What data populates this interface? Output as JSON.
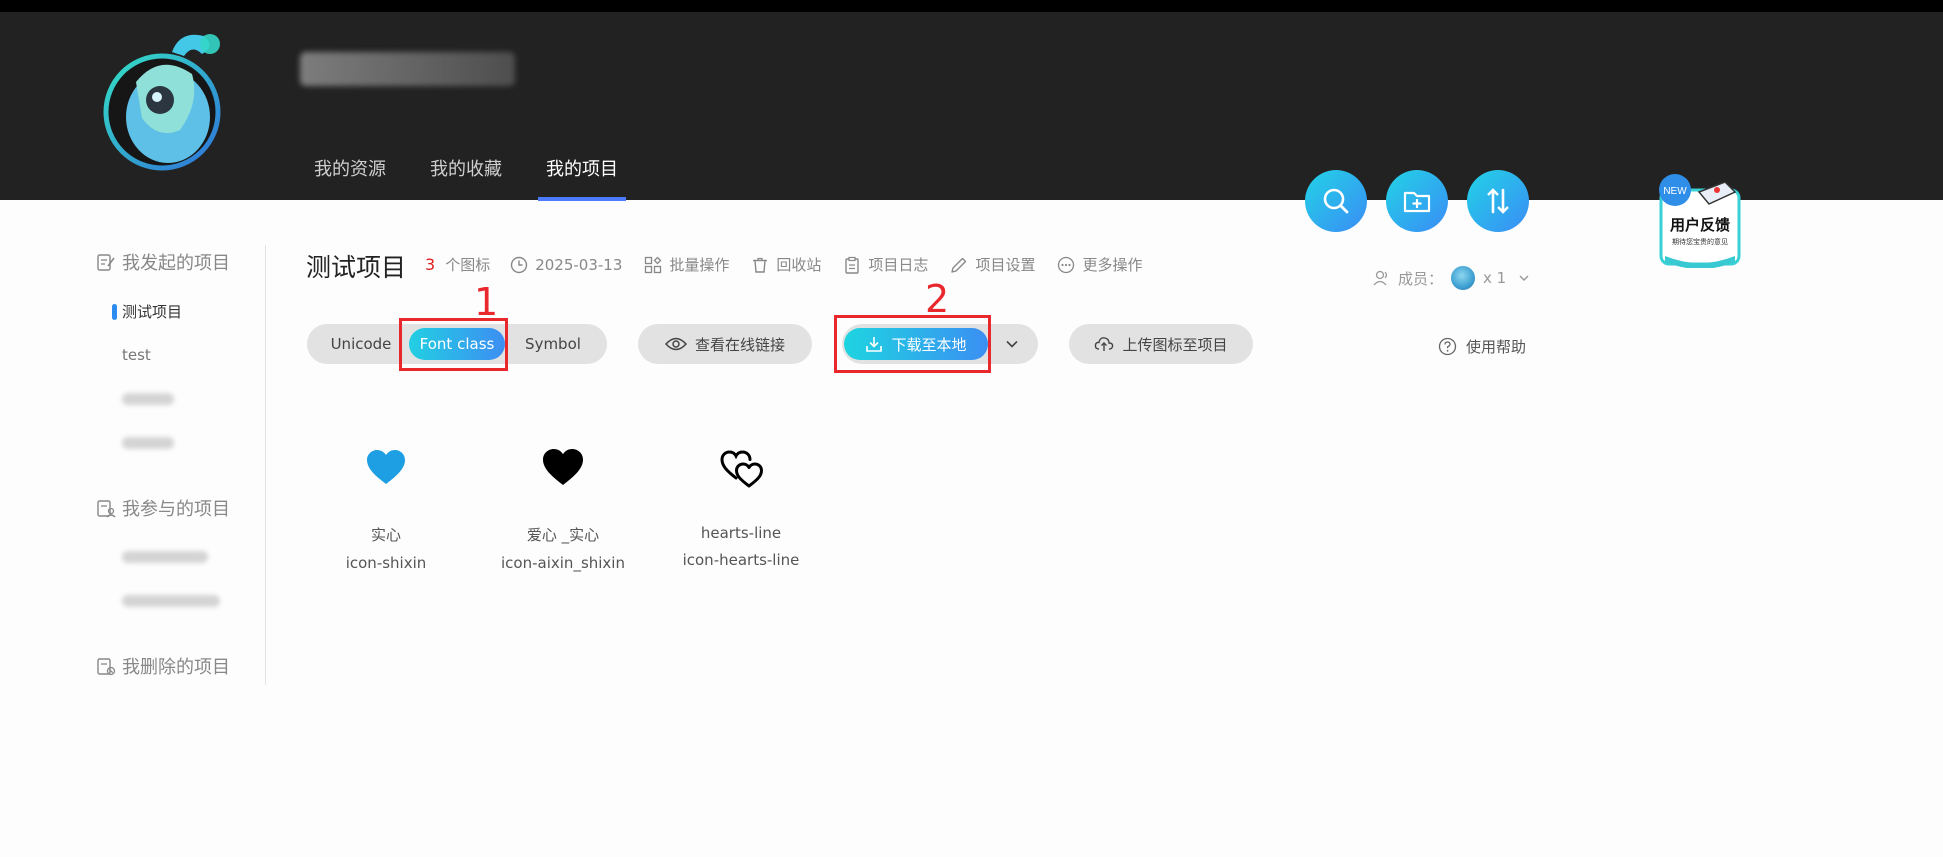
{
  "nav": {
    "items": [
      {
        "label": "我的资源",
        "active": false
      },
      {
        "label": "我的收藏",
        "active": false
      },
      {
        "label": "我的项目",
        "active": true
      }
    ]
  },
  "header_buttons": [
    "search-icon",
    "folder-add-icon",
    "sort-icon"
  ],
  "feedback": {
    "badge": "NEW",
    "title": "用户反馈",
    "subtitle": "期待您宝贵的意见"
  },
  "sidebar": {
    "groups": [
      {
        "label": "我发起的项目",
        "icon": "edit-doc-icon"
      },
      {
        "label": "我参与的项目",
        "icon": "people-doc-icon"
      },
      {
        "label": "我删除的项目",
        "icon": "deleted-doc-icon"
      }
    ],
    "owned_items": [
      "测试项目",
      "test"
    ]
  },
  "project": {
    "title": "测试项目",
    "icon_count": "3",
    "icon_count_label": "个图标",
    "date": "2025-03-13",
    "actions": [
      "批量操作",
      "回收站",
      "项目日志",
      "项目设置",
      "更多操作"
    ],
    "members_label": "成员：",
    "members_count": "x 1"
  },
  "toolbar": {
    "formats": [
      "Unicode",
      "Font class",
      "Symbol"
    ],
    "selected_format": "Font class",
    "view_link": "查看在线链接",
    "download": "下载至本地",
    "upload": "上传图标至项目",
    "help": "使用帮助"
  },
  "annotations": [
    "1",
    "2"
  ],
  "icons": [
    {
      "name": "实心",
      "code": "icon-shixin",
      "color": "#1e9fe3"
    },
    {
      "name": "爱心 _实心",
      "code": "icon-aixin_shixin",
      "color": "#000000"
    },
    {
      "name": "hearts-line",
      "code": "icon-hearts-line",
      "color": "#000000"
    }
  ],
  "colors": {
    "accent": "#2d8cf0",
    "gradient_start": "#22d3e6",
    "gradient_end": "#3a8cf5",
    "annotation": "#e8282c",
    "header_bg": "#222222"
  }
}
